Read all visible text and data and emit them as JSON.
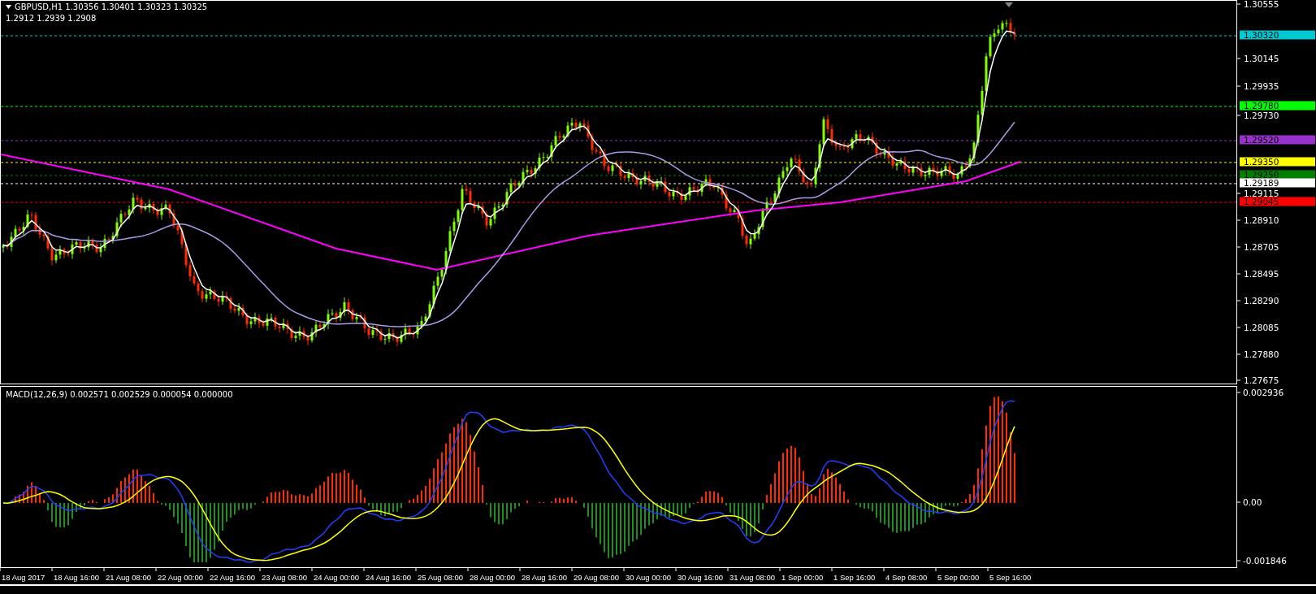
{
  "chart": {
    "header": {
      "symbol_line": "GBPUSD,H1  1.30356 1.30401 1.30323 1.30325",
      "indicator_line": "1.2912 1.2939 1.2908"
    },
    "price_ticks": [
      "1.30555",
      "1.30145",
      "1.29935",
      "1.29730",
      "1.29115",
      "1.28910",
      "1.28705",
      "1.28495",
      "1.28290",
      "1.28085",
      "1.27880",
      "1.27675"
    ],
    "levels": [
      {
        "label": "1.30320",
        "color": "#00c8d2"
      },
      {
        "label": "1.29780",
        "color": "#00ff00"
      },
      {
        "label": "1.29520",
        "color": "#9932cc"
      },
      {
        "label": "1.29350",
        "color": "#ffff00"
      },
      {
        "label": "1.29250",
        "color": "#008000"
      },
      {
        "label": "1.29189",
        "color": "#ffffff"
      },
      {
        "label": "1.29045",
        "color": "#ff0000"
      }
    ]
  },
  "macd": {
    "label": "MACD(12,26,9) 0.002571 0.002529 0.000054 0.000000",
    "ticks": [
      "0.002936",
      "0.00",
      "-0.001846"
    ]
  },
  "time_axis": [
    "18 Aug 2017",
    "18 Aug 16:00",
    "21 Aug 08:00",
    "22 Aug 00:00",
    "22 Aug 16:00",
    "23 Aug 08:00",
    "24 Aug 00:00",
    "24 Aug 16:00",
    "25 Aug 08:00",
    "28 Aug 00:00",
    "28 Aug 16:00",
    "29 Aug 08:00",
    "30 Aug 00:00",
    "30 Aug 16:00",
    "31 Aug 08:00",
    "1 Sep 00:00",
    "1 Sep 16:00",
    "4 Sep 08:00",
    "5 Sep 00:00",
    "5 Sep 16:00"
  ]
}
